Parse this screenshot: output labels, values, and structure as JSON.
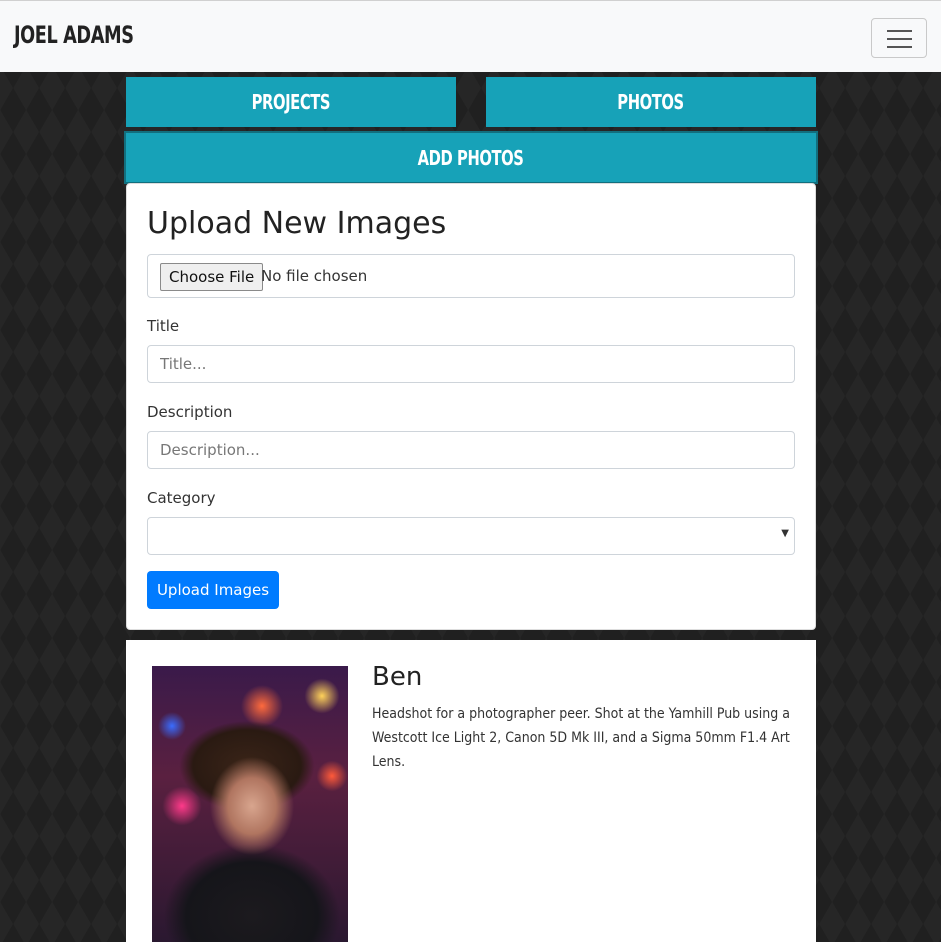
{
  "navbar": {
    "brand": "JOEL ADAMS",
    "toggle_icon": "hamburger-menu-icon"
  },
  "tabs": [
    {
      "label": "PROJECTS"
    },
    {
      "label": "PHOTOS"
    },
    {
      "label": "ADD PHOTOS"
    }
  ],
  "upload_form": {
    "heading": "Upload New Images",
    "file_button": "Choose File",
    "file_status": "No file chosen",
    "title_label": "Title",
    "title_placeholder": "Title...",
    "description_label": "Description",
    "description_placeholder": "Description...",
    "category_label": "Category",
    "category_value": "",
    "submit_label": "Upload Images"
  },
  "photo": {
    "title": "Ben",
    "description": "Headshot for a photographer peer. Shot at the Yamhill Pub using a Westcott Ice Light 2, Canon 5D Mk III, and a Sigma 50mm F1.4 Art Lens."
  },
  "colors": {
    "accent": "#17a2b8",
    "primary": "#007bff",
    "navbar_bg": "#f8f9fa",
    "page_bg": "#202020"
  }
}
